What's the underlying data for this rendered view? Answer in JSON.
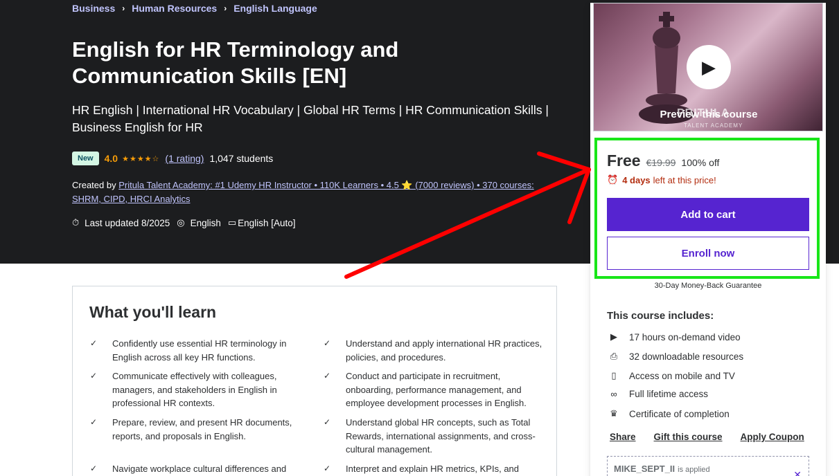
{
  "breadcrumb": [
    {
      "label": "Business"
    },
    {
      "label": "Human Resources"
    },
    {
      "label": "English Language"
    }
  ],
  "course": {
    "title": "English for HR Terminology and Communication Skills [EN]",
    "subtitle": "HR English | International HR Vocabulary | Global HR Terms | HR Communication Skills | Business English for HR",
    "badge": "New",
    "rating": "4.0",
    "stars": "★★★★☆",
    "rating_count": "(1 rating)",
    "students": "1,047 students",
    "created_by_label": "Created by",
    "instructor": "Pritula Talent Academy: #1 Udemy HR Instructor • 110K Learners • 4.5 ⭐ (7000 reviews) • 370 courses: SHRM, CIPD, HRCI Analytics",
    "last_updated": "Last updated 8/2025",
    "language": "English",
    "captions": "English [Auto]"
  },
  "learn": {
    "title": "What you'll learn",
    "items": [
      "Confidently use essential HR terminology in English across all key HR functions.",
      "Understand and apply international HR practices, policies, and procedures.",
      "Communicate effectively with colleagues, managers, and stakeholders in English in professional HR contexts.",
      "Conduct and participate in recruitment, onboarding, performance management, and employee development processes in English.",
      "Prepare, review, and present HR documents, reports, and proposals in English.",
      "Understand global HR concepts, such as Total Rewards, international assignments, and cross-cultural management.",
      "Navigate workplace cultural differences and",
      "Interpret and explain HR metrics, KPIs, and"
    ]
  },
  "sidebar": {
    "preview_label": "Preview this course",
    "preview_brand": "PRITULA",
    "preview_brand_sub": "TALENT ACADEMY",
    "price": "Free",
    "original_price": "€19.99",
    "discount": "100% off",
    "timer_bold": "4 days",
    "timer_rest": "left at this price!",
    "add_to_cart": "Add to cart",
    "enroll_now": "Enroll now",
    "guarantee": "30-Day Money-Back Guarantee",
    "includes_title": "This course includes:",
    "includes": [
      {
        "icon": "video-icon",
        "label": "17 hours on-demand video"
      },
      {
        "icon": "file-download-icon",
        "label": "32 downloadable resources"
      },
      {
        "icon": "mobile-icon",
        "label": "Access on mobile and TV"
      },
      {
        "icon": "infinity-icon",
        "label": "Full lifetime access"
      },
      {
        "icon": "trophy-icon",
        "label": "Certificate of completion"
      }
    ],
    "share": "Share",
    "gift": "Gift this course",
    "apply_coupon": "Apply Coupon",
    "coupon_code": "MIKE_SEPT_II",
    "coupon_status": "is applied"
  },
  "colors": {
    "hero_bg": "#1c1d1f",
    "accent_purple": "#5624d0",
    "link_purple": "#c0c4fc",
    "star_orange": "#f69c08",
    "timer_red": "#b32d0f",
    "highlight_green": "#19e619",
    "arrow_red": "#ff0000"
  }
}
